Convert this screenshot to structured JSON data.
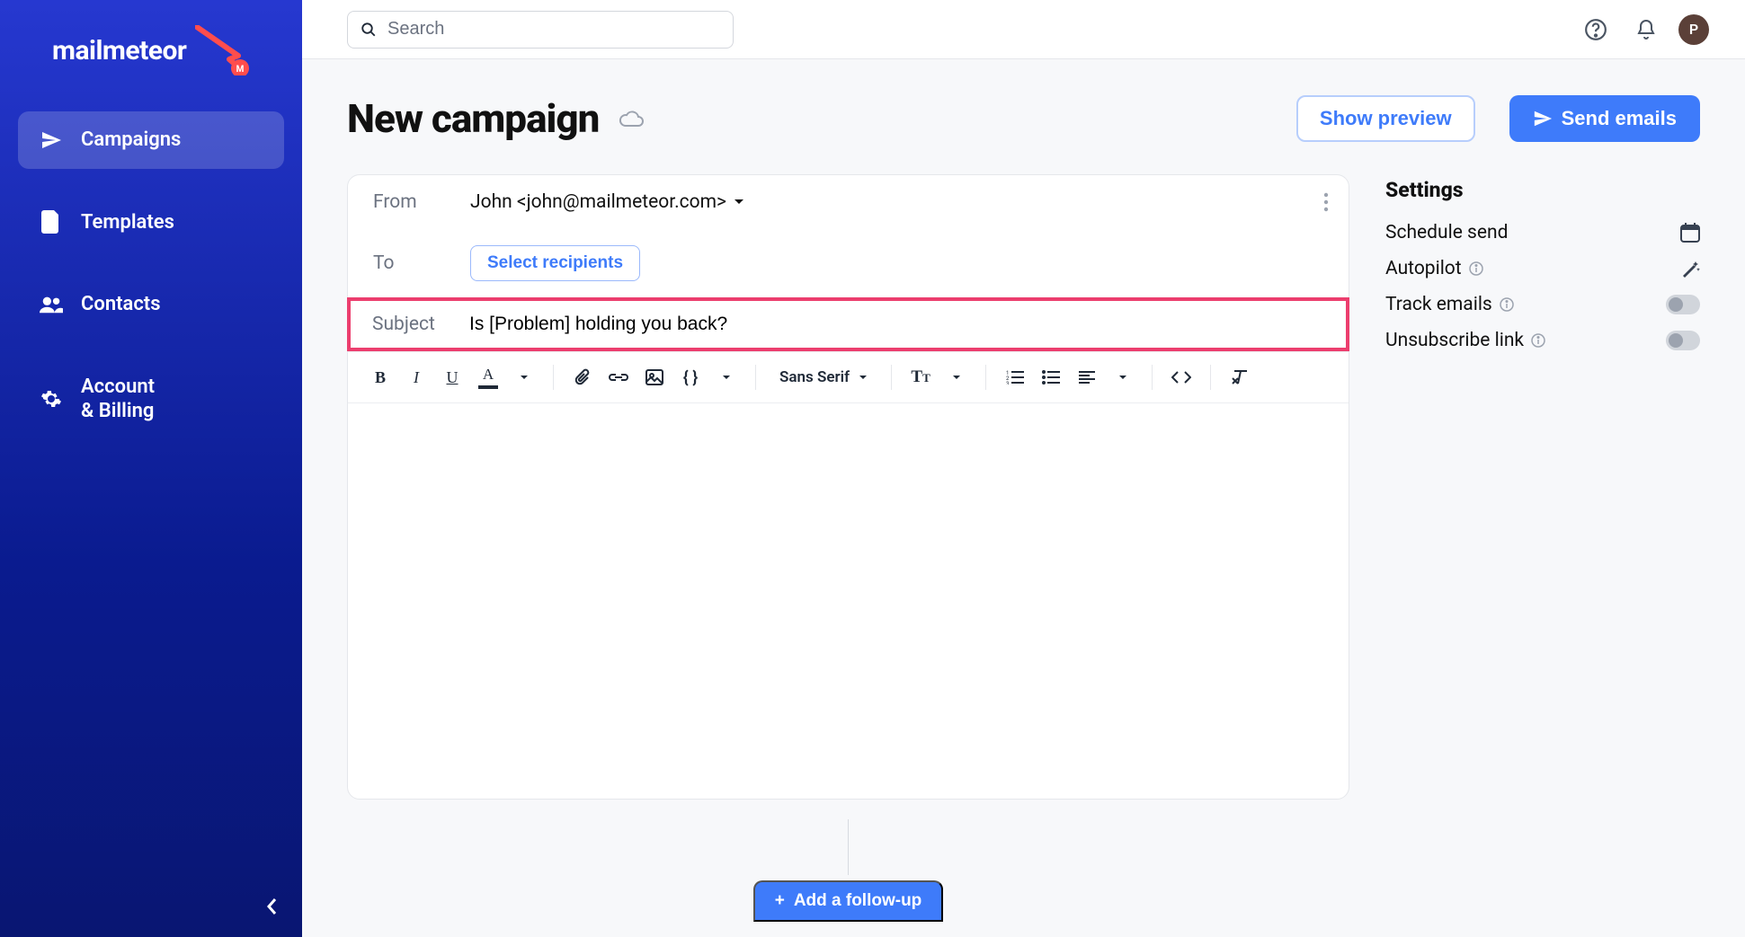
{
  "brand": {
    "name": "mailmeteor"
  },
  "sidebar": {
    "items": [
      {
        "label": "Campaigns",
        "icon": "send"
      },
      {
        "label": "Templates",
        "icon": "file"
      },
      {
        "label": "Contacts",
        "icon": "people"
      },
      {
        "label": "Account\n& Billing",
        "icon": "gear"
      }
    ],
    "activeIndex": 0
  },
  "topbar": {
    "search_placeholder": "Search",
    "avatar_initial": "P"
  },
  "header": {
    "title": "New campaign",
    "show_preview": "Show preview",
    "send_emails": "Send emails"
  },
  "composer": {
    "from_label": "From",
    "from_value": "John <john@mailmeteor.com>",
    "to_label": "To",
    "select_recipients": "Select recipients",
    "subject_label": "Subject",
    "subject_value": "Is [Problem] holding you back?",
    "font_name": "Sans Serif"
  },
  "settings": {
    "title": "Settings",
    "rows": [
      {
        "label": "Schedule send",
        "control": "calendar"
      },
      {
        "label": "Autopilot",
        "info": true,
        "control": "wand"
      },
      {
        "label": "Track emails",
        "info": true,
        "control": "toggle"
      },
      {
        "label": "Unsubscribe link",
        "info": true,
        "control": "toggle"
      }
    ]
  },
  "followup": {
    "label": "Add a follow-up"
  }
}
